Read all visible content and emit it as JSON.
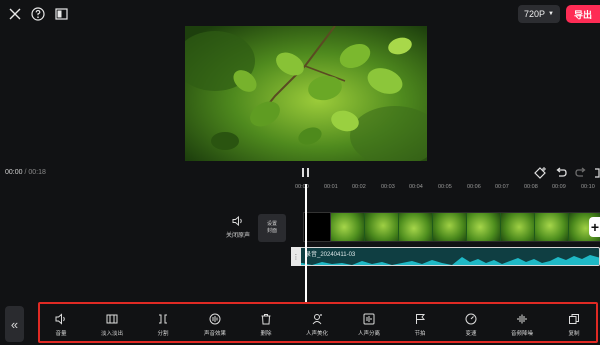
{
  "top_bar": {
    "resolution": "720P",
    "export_label": "导出"
  },
  "playback": {
    "current_time": "00:00",
    "separator": " / ",
    "total_time": "00:18"
  },
  "timeline": {
    "ruler_ticks": [
      "00:00",
      "00:01",
      "00:02",
      "00:03",
      "00:04",
      "00:05",
      "00:06",
      "00:07",
      "00:08",
      "00:09",
      "00:10"
    ],
    "mute_label": "关闭原声",
    "cover_label_1": "设置",
    "cover_label_2": "封面",
    "audio_label": "录音_20240411-03"
  },
  "toolbar": {
    "collapse_icon": "«",
    "tools": [
      {
        "label": "音量",
        "icon": "volume-icon"
      },
      {
        "label": "淡入淡出",
        "icon": "fade-icon"
      },
      {
        "label": "分割",
        "icon": "split-icon"
      },
      {
        "label": "声音效果",
        "icon": "sound-effect-icon"
      },
      {
        "label": "删除",
        "icon": "delete-icon"
      },
      {
        "label": "人声美化",
        "icon": "voice-beautify-icon"
      },
      {
        "label": "人声分离",
        "icon": "voice-separate-icon"
      },
      {
        "label": "节拍",
        "icon": "beat-flag-icon"
      },
      {
        "label": "变速",
        "icon": "speed-icon"
      },
      {
        "label": "音频降噪",
        "icon": "noise-reduction-icon"
      },
      {
        "label": "复制",
        "icon": "copy-icon"
      }
    ]
  },
  "colors": {
    "accent": "#fe2c55",
    "audio_wave": "#1fb9c6",
    "toolbar_border": "#e02a24"
  }
}
